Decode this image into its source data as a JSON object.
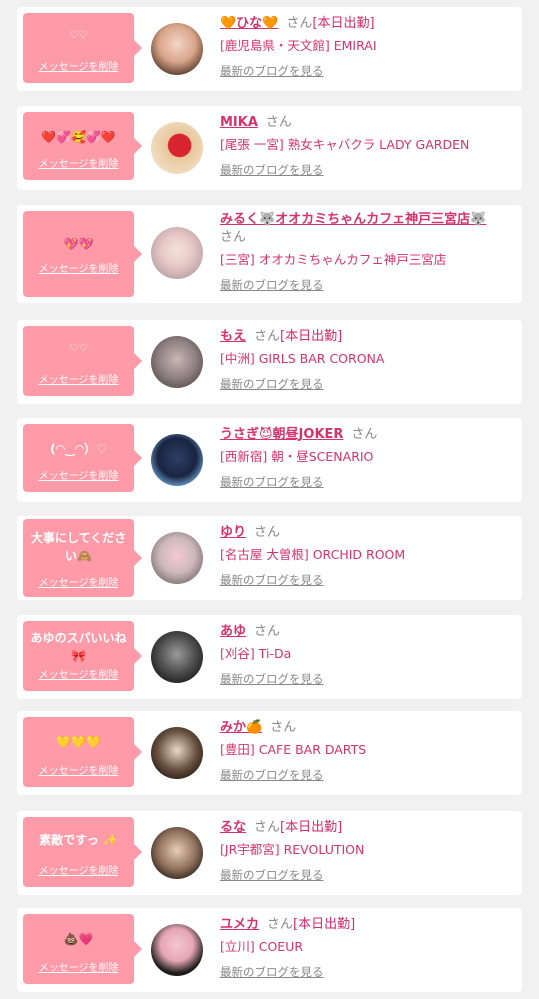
{
  "delete_label": "メッセージを削除",
  "blog_label": "最新のブログを見る",
  "san_label": "さん",
  "work_label": "[本日出勤]",
  "colors": {
    "bubble": "#ff9aa8",
    "name": "#d6336c",
    "background": "#f1f1f1"
  },
  "cards": [
    {
      "message": "♡♡",
      "name": "🧡ひな🧡",
      "suffix": "さん",
      "work": "[本日出勤]",
      "shop": "[鹿児島県・天文館] EMIRAI",
      "avatar_icon": "avatar-photo"
    },
    {
      "message": "❤️💞🥰💞❤️",
      "name": "MIKA",
      "suffix": "さん",
      "work": "",
      "shop": "[尾張 一宮] 熟女キャバクラ LADY GARDEN",
      "avatar_icon": "avatar-photo"
    },
    {
      "message": "💖💖",
      "name": "みるく🐺オオカミちゃんカフェ神戸三宮店🐺",
      "suffix": "さん",
      "work": "",
      "shop": "[三宮] オオカミちゃんカフェ神戸三宮店",
      "avatar_icon": "avatar-photo"
    },
    {
      "message": "♡♡",
      "name": "もえ",
      "suffix": "さん",
      "work": "[本日出勤]",
      "shop": "[中洲] GIRLS BAR CORONA",
      "avatar_icon": "avatar-photo"
    },
    {
      "message": "(◠‿◠）♡",
      "name": "うさぎ😈朝昼JOKER",
      "suffix": "さん",
      "work": "",
      "shop": "[西新宿] 朝・昼SCENARIO",
      "avatar_icon": "avatar-photo"
    },
    {
      "message": "大事にしてください🙈",
      "name": "ゆり",
      "suffix": "さん",
      "work": "",
      "shop": "[名古屋 大曽根] ORCHID ROOM",
      "avatar_icon": "avatar-photo"
    },
    {
      "message": "あゆのスパいいね🎀",
      "name": "あゆ",
      "suffix": "さん",
      "work": "",
      "shop": "[刈谷] Ti-Da",
      "avatar_icon": "avatar-photo"
    },
    {
      "message": "💛💛💛",
      "name": "みか🍊",
      "suffix": "さん",
      "work": "",
      "shop": "[豊田] CAFE BAR DARTS",
      "avatar_icon": "avatar-photo"
    },
    {
      "message": "素敵ですっ ✨",
      "name": "るな",
      "suffix": "さん",
      "work": "[本日出勤]",
      "shop": "[JR宇都宮] REVOLUTION",
      "avatar_icon": "avatar-photo"
    },
    {
      "message": "💩💗",
      "name": "ユメカ",
      "suffix": "さん",
      "work": "[本日出勤]",
      "shop": "[立川] COEUR",
      "avatar_icon": "avatar-photo"
    }
  ]
}
